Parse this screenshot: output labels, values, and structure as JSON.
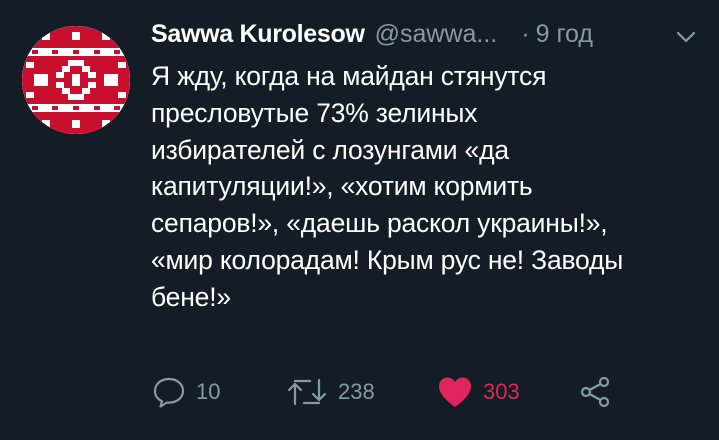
{
  "tweet": {
    "author": {
      "display_name": "Sawwa Kurolesow",
      "handle": "@sawwa...",
      "avatar_icon": "belarusian-ornament-avatar"
    },
    "separator": "·",
    "timestamp": "9 год",
    "menu_icon": "chevron-down-icon",
    "text_lines": [
      "Я жду,  когда на майдан стянутся",
      "пресловутые 73% зелиных",
      "избирателей с лозунгами «да",
      "капитуляции!», «хотим кормить",
      "сепаров!», «даешь раскол украины!»,",
      "«мир колорадам! Крым рус  не! Заводы",
      "бене!»"
    ],
    "actions": {
      "reply": {
        "icon": "reply-icon",
        "count": "10"
      },
      "retweet": {
        "icon": "retweet-icon",
        "count": "238"
      },
      "like": {
        "icon": "heart-icon",
        "count": "303",
        "liked": true
      },
      "share": {
        "icon": "share-icon"
      }
    }
  },
  "colors": {
    "background": "#141d26",
    "text": "#ffffff",
    "secondary": "#8899a6",
    "like": "#e0245e",
    "avatar_red": "#c8102e"
  }
}
